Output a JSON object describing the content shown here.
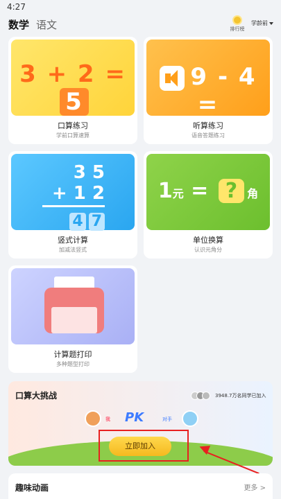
{
  "status": {
    "time": "4:27"
  },
  "header": {
    "tabs": [
      {
        "label": "数学"
      },
      {
        "label": "语文"
      }
    ],
    "rank_label": "排行榜",
    "grade_label": "学龄前"
  },
  "cards": [
    {
      "title": "口算练习",
      "subtitle": "学前口算速算",
      "art": {
        "a": "3",
        "op": "+",
        "b": "2",
        "eq": "=",
        "ans": "5"
      }
    },
    {
      "title": "听算练习",
      "subtitle": "语音答题练习",
      "art": {
        "a": "9",
        "op": "-",
        "b": "4",
        "eq": "="
      }
    },
    {
      "title": "竖式计算",
      "subtitle": "加减法竖式",
      "art": {
        "top": "3 5",
        "bottom": "+ 1 2",
        "ans1": "4",
        "ans2": "7"
      }
    },
    {
      "title": "单位换算",
      "subtitle": "认识元角分",
      "art": {
        "num": "1",
        "unit1": "元",
        "eq": "=",
        "q": "?",
        "unit2": "角"
      }
    },
    {
      "title": "计算题打印",
      "subtitle": "多种题型打印"
    }
  ],
  "challenge": {
    "title": "口算大挑战",
    "count_text": "3948.7万名同学已加入",
    "me_label": "我",
    "pk_label": "PK",
    "opponent_label": "对手",
    "join_label": "立即加入"
  },
  "animation": {
    "title": "趣味动画",
    "more_label": "更多 >"
  },
  "colors": {
    "highlight": "#e82020",
    "join_button": "#f5b91f",
    "pk": "#3d7bff"
  }
}
